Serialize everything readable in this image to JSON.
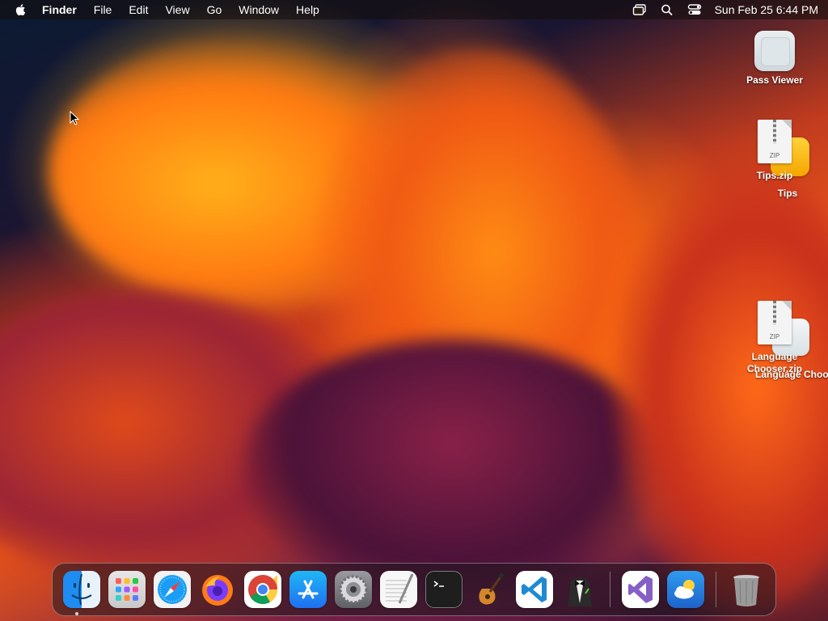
{
  "menubar": {
    "app_name": "Finder",
    "items": [
      "File",
      "Edit",
      "View",
      "Go",
      "Window",
      "Help"
    ],
    "clock": "Sun Feb 25  6:44 PM",
    "status_icons": [
      "screen-mirroring-icon",
      "spotlight-search-icon",
      "control-center-icon"
    ]
  },
  "desktop": {
    "icons": [
      {
        "label": "Pass Viewer",
        "icon": "pass-viewer-icon"
      },
      {
        "label": "Tips.zip",
        "icon": "zip-archive-icon"
      },
      {
        "label": "Tips",
        "icon": "tips-app-icon"
      },
      {
        "label": "Language",
        "icon": "zip-archive-icon"
      },
      {
        "label": "Chooser.zip",
        "icon": "zip-archive-icon"
      },
      {
        "label": "Language Chooser",
        "icon": "language-chooser-icon"
      }
    ]
  },
  "dock": {
    "apps": [
      {
        "name": "finder-icon",
        "color": "#1e8cf0"
      },
      {
        "name": "launchpad-icon",
        "color": "#d9d9d9"
      },
      {
        "name": "safari-icon",
        "color": "#1a9ef5"
      },
      {
        "name": "firefox-icon",
        "color": "#ff7a18"
      },
      {
        "name": "chrome-icon",
        "color": "#ffffff"
      },
      {
        "name": "app-store-icon",
        "color": "#1f8ef1"
      },
      {
        "name": "system-settings-icon",
        "color": "#8e8e93"
      },
      {
        "name": "textedit-icon",
        "color": "#f7f7f7"
      },
      {
        "name": "terminal-icon",
        "color": "#1e1e1e"
      },
      {
        "name": "garageband-icon",
        "color": "#3a3a3a"
      },
      {
        "name": "vscode-icon",
        "color": "#ffffff"
      },
      {
        "name": "alfred-icon",
        "color": "#2b2b2b"
      },
      {
        "name": "visual-studio-icon",
        "color": "#ffffff"
      },
      {
        "name": "weather-icon",
        "color": "#2d8ee6"
      },
      {
        "name": "trash-icon",
        "color": "#9a9a9a"
      }
    ]
  }
}
